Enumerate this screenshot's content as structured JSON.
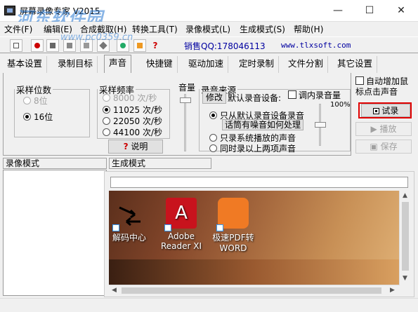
{
  "window": {
    "title": "屏幕录像专家 V2015",
    "minimize": "—",
    "maximize": "☐",
    "close": "✕"
  },
  "watermark": {
    "text": "河东软件园",
    "url": "www.pc0359.cn"
  },
  "menu": [
    "文件(F)",
    "编辑(E)",
    "合成截取(H)",
    "转换工具(T)",
    "录像模式(L)",
    "生成模式(S)",
    "帮助(H)"
  ],
  "toolbar": {
    "sales": "销售QQ:178046113",
    "site": "www.tlxsoft.com",
    "help_icon": "?"
  },
  "tabs": [
    "基本设置",
    "录制目标",
    "声音",
    "快捷键",
    "驱动加速",
    "定时录制",
    "文件分割",
    "其它设置"
  ],
  "active_tab": "声音",
  "sample_bits": {
    "legend": "采样位数",
    "options": [
      {
        "label": "8位",
        "selected": false,
        "disabled": true
      },
      {
        "label": "16位",
        "selected": true,
        "disabled": false
      }
    ]
  },
  "sample_rate": {
    "legend": "采样频率",
    "options": [
      {
        "label": "8000 次/秒",
        "selected": false,
        "disabled": true
      },
      {
        "label": "11025 次/秒",
        "selected": true,
        "disabled": false
      },
      {
        "label": "22050 次/秒",
        "selected": false,
        "disabled": false
      },
      {
        "label": "44100 次/秒",
        "selected": false,
        "disabled": false
      }
    ],
    "help_button": "说明"
  },
  "volume": {
    "label": "音量",
    "percent_label": "100%"
  },
  "source": {
    "legend": "录音来源",
    "modify_button": "修改",
    "device_label": "默认录音设备:",
    "internal_label": "调内录音量",
    "options": [
      {
        "label": "只从默认录音设备录音",
        "selected": true
      },
      {
        "label": "只录系统播放的声音",
        "selected": false
      },
      {
        "label": "同时录以上两项声音",
        "selected": false
      }
    ],
    "noise_button": "话筒有噪音如何处理"
  },
  "side": {
    "auto_click": "自动增加鼠标点击声音",
    "test_button": "试录",
    "play_button": "播放",
    "save_button": "保存"
  },
  "sections": {
    "record_mode": "录像模式",
    "generate_mode": "生成模式"
  },
  "desktop_icons": [
    {
      "label": "解码中心"
    },
    {
      "label": "Adobe Reader XI"
    },
    {
      "label": "极速PDF转WORD"
    }
  ]
}
